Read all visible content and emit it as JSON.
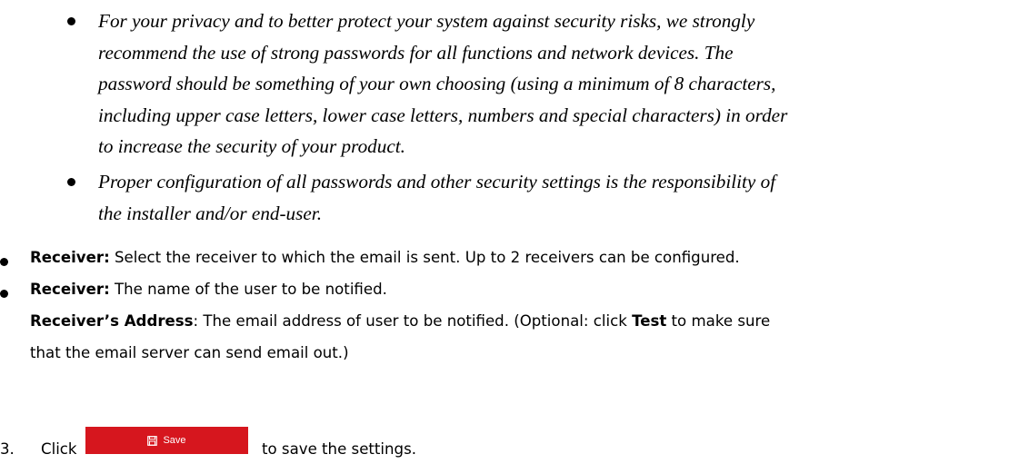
{
  "nested_bullets": [
    {
      "lines": [
        "For your privacy and to better protect your system against security risks, we strongly",
        "recommend the use of strong passwords for all functions and network devices. The",
        "password should be something of your own choosing (using a minimum of 8 characters,",
        "including upper case letters, lower case letters, numbers and special characters) in order",
        "to increase the security of your product."
      ]
    },
    {
      "lines": [
        "Proper configuration of all passwords and other security settings is the responsibility of",
        "the installer and/or end-user."
      ]
    }
  ],
  "items": [
    {
      "term": "Receiver:",
      "text": " Select the receiver to which the email is sent. Up to 2 receivers can be configured."
    },
    {
      "term": "Receiver:",
      "text": " The name of the user to be notified."
    }
  ],
  "address_para": {
    "term": "Receiver’s Address",
    "line1_text": ": The email address of user to be notified. (Optional: click ",
    "test_label": "Test",
    "line1_tail": " to make sure",
    "line2": "that the email server can send email out.)"
  },
  "step": {
    "number": "3.",
    "text_before": "Click",
    "button_label": "Save",
    "button_icon": "save-icon",
    "text_after": "to save the settings."
  },
  "colors": {
    "save_button": "#d6161e"
  }
}
